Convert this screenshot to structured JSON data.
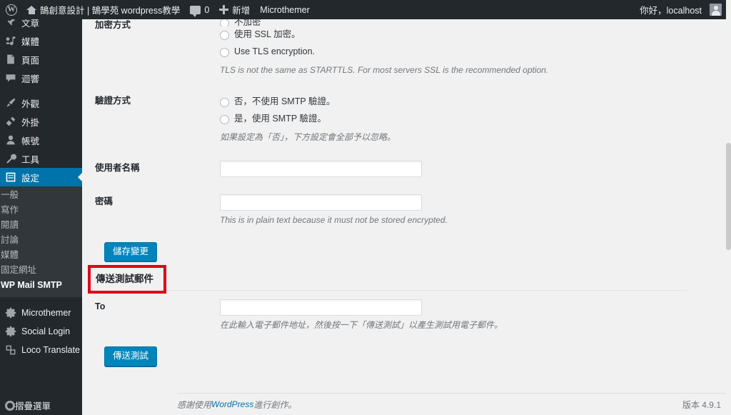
{
  "adminbar": {
    "wp_logo_icon": "wordpress-logo-icon",
    "home_icon": "home-icon",
    "site_name": "鵠創意設計 | 鵠學苑 wordpress教學",
    "comment_icon": "comment-bubble-icon",
    "comment_count": "0",
    "plus_icon": "plus-icon",
    "new_label": "新增",
    "microthemer_label": "Microthemer",
    "greeting": "你好，localhost",
    "avatar_icon": "avatar-icon"
  },
  "sidebar": {
    "items": [
      {
        "label": "文章",
        "icon": "pin-icon",
        "active": false
      },
      {
        "label": "媒體",
        "icon": "media-icon",
        "active": false
      },
      {
        "label": "頁面",
        "icon": "page-icon",
        "active": false
      },
      {
        "label": "迴響",
        "icon": "comment-icon",
        "active": false
      },
      {
        "label": "外觀",
        "icon": "appearance-brush-icon",
        "active": false
      },
      {
        "label": "外掛",
        "icon": "plugin-icon",
        "active": false
      },
      {
        "label": "帳號",
        "icon": "users-icon",
        "active": false
      },
      {
        "label": "工具",
        "icon": "tools-wrench-icon",
        "active": false
      },
      {
        "label": "設定",
        "icon": "settings-sliders-icon",
        "active": true
      }
    ],
    "submenu": [
      {
        "label": "一般",
        "current": false
      },
      {
        "label": "寫作",
        "current": false
      },
      {
        "label": "閱讀",
        "current": false
      },
      {
        "label": "討論",
        "current": false
      },
      {
        "label": "媒體",
        "current": false
      },
      {
        "label": "固定網址",
        "current": false
      },
      {
        "label": "WP Mail SMTP",
        "current": true
      }
    ],
    "plugins": [
      {
        "label": "Microthemer",
        "icon": "gear-icon"
      },
      {
        "label": "Social Login",
        "icon": "gear-icon"
      },
      {
        "label": "Loco Translate",
        "icon": "translate-icon"
      }
    ],
    "collapse": {
      "label": "摺疊選單",
      "icon": "collapse-circle-icon"
    }
  },
  "main": {
    "encryption_row": {
      "label": "加密方式",
      "option_none": "不加密",
      "option_ssl": "使用 SSL 加密。",
      "option_tls": "Use TLS encryption.",
      "note": "TLS is not the same as STARTTLS. For most servers SSL is the recommended option."
    },
    "auth_row": {
      "label": "驗證方式",
      "option_no": "否，不使用 SMTP 驗證。",
      "option_yes": "是，使用 SMTP 驗證。",
      "note": "如果設定為「否」，下方設定會全部予以忽略。"
    },
    "username_row": {
      "label": "使用者名稱",
      "value": "",
      "placeholder": ""
    },
    "password_row": {
      "label": "密碼",
      "value": "",
      "placeholder": "",
      "note": "This is in plain text because it must not be stored encrypted."
    },
    "save_button": "儲存變更",
    "test_email": {
      "heading": "傳送測試郵件",
      "to_label": "To",
      "to_value": "",
      "to_placeholder": "",
      "note": "在此輸入電子郵件地址，然後按一下「傳送測試」以產生測試用電子郵件。",
      "send_button": "傳送測試"
    },
    "annotation_color": "#e2001a"
  },
  "footer": {
    "thanks_prefix": "感謝使用 ",
    "wordpress_link": "WordPress",
    "thanks_suffix": " 進行創作。",
    "version": "版本 4.9.1"
  },
  "colors": {
    "admin_dark": "#23282d",
    "submenu_dark": "#32373c",
    "accent_blue": "#0073aa",
    "button_blue": "#0085ba",
    "page_bg": "#f1f1f1",
    "annotation_red": "#e2001a"
  }
}
